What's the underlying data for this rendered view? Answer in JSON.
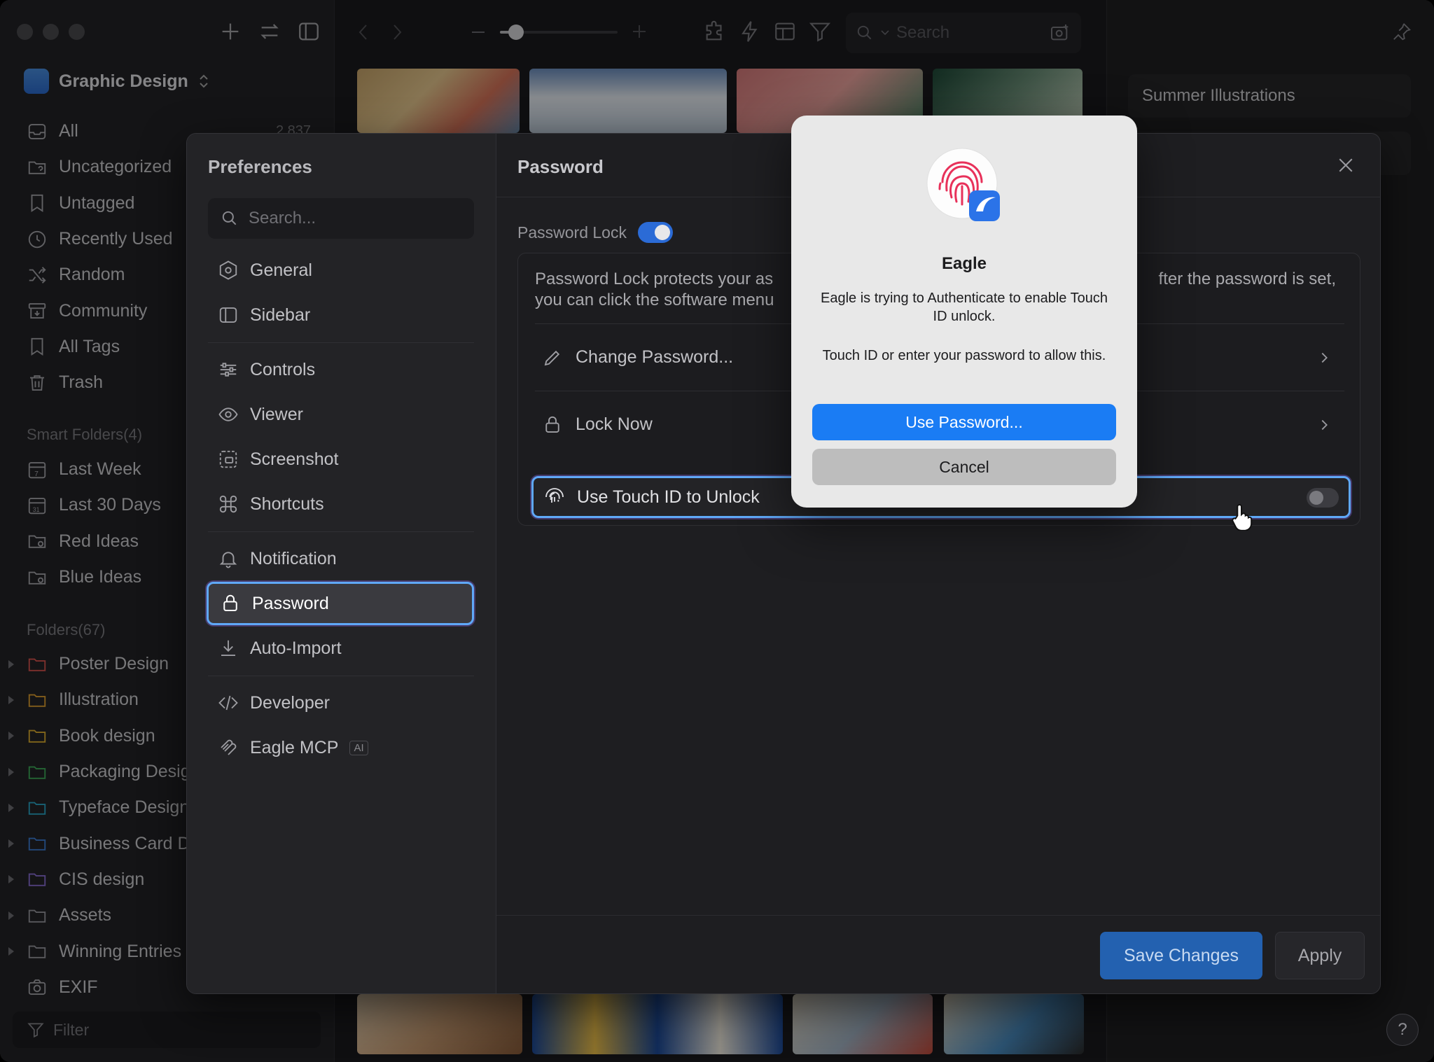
{
  "sidebar": {
    "library_title": "Graphic Design",
    "items": [
      {
        "label": "All",
        "count": "2,837"
      },
      {
        "label": "Uncategorized"
      },
      {
        "label": "Untagged"
      },
      {
        "label": "Recently Used"
      },
      {
        "label": "Random"
      },
      {
        "label": "Community"
      },
      {
        "label": "All Tags"
      },
      {
        "label": "Trash"
      }
    ],
    "smart_folders_title": "Smart Folders(4)",
    "smart_folders": [
      {
        "label": "Last Week"
      },
      {
        "label": "Last 30 Days"
      },
      {
        "label": "Red Ideas"
      },
      {
        "label": "Blue Ideas"
      }
    ],
    "folders_title": "Folders(67)",
    "folders": [
      {
        "label": "Poster Design",
        "color": "#d9534f"
      },
      {
        "label": "Illustration",
        "color": "#e0a030"
      },
      {
        "label": "Book design",
        "color": "#e0b030"
      },
      {
        "label": "Packaging Desig",
        "color": "#3fae5a"
      },
      {
        "label": "Typeface Design",
        "color": "#2aa7c9"
      },
      {
        "label": "Business Card D",
        "color": "#3d7fd6"
      },
      {
        "label": "CIS design",
        "color": "#8a6fd6"
      },
      {
        "label": "Assets",
        "color": "#9a9aa0"
      },
      {
        "label": "Winning Entries",
        "color": "#9a9aa0"
      }
    ],
    "exif_label": "EXIF",
    "filter_placeholder": "Filter"
  },
  "toolbar": {
    "search_placeholder": "Search",
    "zoom_level": 0.12
  },
  "right_panel": {
    "folder_name": "Summer Illustrations"
  },
  "preferences": {
    "title": "Preferences",
    "search_placeholder": "Search...",
    "nav": [
      {
        "label": "General"
      },
      {
        "label": "Sidebar"
      },
      {
        "label": "Controls"
      },
      {
        "label": "Viewer"
      },
      {
        "label": "Screenshot"
      },
      {
        "label": "Shortcuts"
      },
      {
        "label": "Notification"
      },
      {
        "label": "Password"
      },
      {
        "label": "Auto-Import"
      },
      {
        "label": "Developer"
      },
      {
        "label": "Eagle MCP",
        "badge": "AI"
      }
    ],
    "pane": {
      "title": "Password",
      "lock_label": "Password Lock",
      "lock_enabled": true,
      "description_line1": "Password Lock protects your as",
      "description_line1_tail": "fter the password is set,",
      "description_line2": "you can click the software menu",
      "change_password": "Change Password...",
      "lock_now": "Lock Now",
      "touch_id": "Use Touch ID to Unlock",
      "touch_id_enabled": false
    },
    "save_label": "Save Changes",
    "apply_label": "Apply"
  },
  "auth_dialog": {
    "app_name": "Eagle",
    "message": "Eagle is trying to Authenticate to enable Touch ID unlock.",
    "message2": "Touch ID or enter your password to allow this.",
    "primary_label": "Use Password...",
    "cancel_label": "Cancel"
  },
  "help_label": "?"
}
